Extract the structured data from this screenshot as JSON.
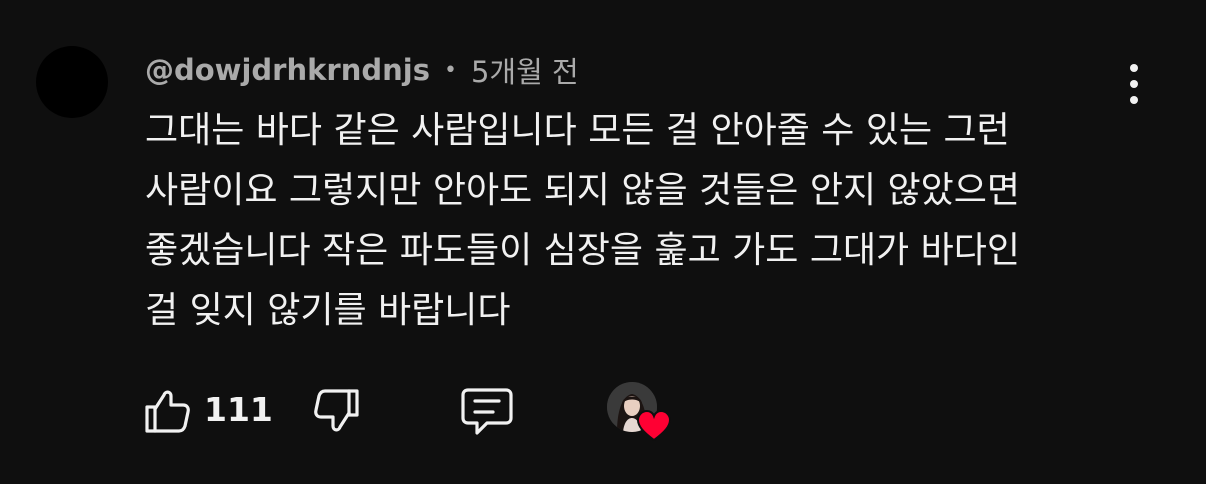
{
  "comment": {
    "author": "@dowjdrhkrndnjs",
    "separator": "•",
    "time": "5개월 전",
    "text_lines": [
      "그대는 바다 같은 사람입니다 모든 걸 안아줄 수 있는 그런",
      "사람이요 그렇지만 안아도 되지 않을 것들은 안지 않았으면",
      "좋겠습니다 작은 파도들이 심장을 훑고 가도 그대가 바다인",
      "걸 잊지 않기를 바랍니다"
    ]
  },
  "actions": {
    "like_icon": "thumbs-up-icon",
    "like_count": "111",
    "dislike_icon": "thumbs-down-icon",
    "reply_icon": "comment-icon",
    "creator_heart": "creator-heart-icon",
    "more_icon": "more-vert-icon"
  },
  "colors": {
    "background": "#0f0f0f",
    "text": "#f1f1f1",
    "secondary_text": "#aaaaaa",
    "heart": "#ff0033"
  }
}
